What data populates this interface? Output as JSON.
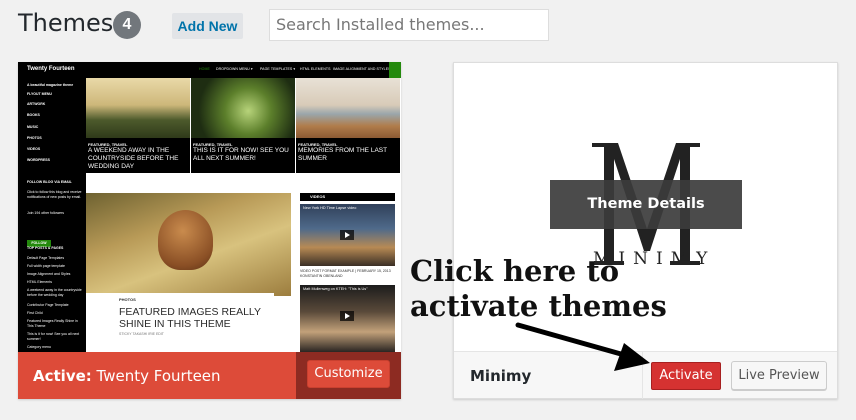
{
  "header": {
    "title": "Themes",
    "count": "4",
    "add_new": "Add New",
    "search_placeholder": "Search Installed themes..."
  },
  "active_theme": {
    "prefix": "Active:",
    "name": "Twenty Fourteen",
    "customize_label": "Customize",
    "screenshot": {
      "brand": "Twenty Fourteen",
      "tagline": "A beautiful magazine theme",
      "nav": [
        "HOME",
        "DROPDOWN MENU ▾",
        "PAGE TEMPLATES ▾",
        "HTML ELEMENTS",
        "IMAGE ALIGNMENT AND STYLES"
      ],
      "sidebar_menu": [
        "FLYOUT MENU",
        "ARTWORK",
        "BOOKS",
        "MUSIC",
        "PHOTOS",
        "VIDEOS",
        "WORDPRESS"
      ],
      "follow_heading": "FOLLOW BLOG VIA EMAIL",
      "follow_text": "Click to follow this blog and receive notifications of new posts by email.",
      "follow_count": "Join 194 other followers",
      "follow_button": "FOLLOW",
      "top_posts_heading": "TOP POSTS & PAGES",
      "top_posts": [
        "Default Page Templates",
        "Full width page template",
        "Image Alignment and Styles",
        "HTML Elements",
        "A weekend away in the countryside before the wedding day",
        "Contributor Page Template",
        "First Child",
        "Featured Images Really Shine in This Theme",
        "This is it for now! See you all next summer!",
        "Category menu"
      ],
      "featured": [
        {
          "category": "FEATURED, TRAVEL",
          "title": "A WEEKEND AWAY IN THE COUNTRYSIDE BEFORE THE WEDDING DAY"
        },
        {
          "category": "FEATURED, TRAVEL",
          "title": "THIS IS IT FOR NOW! SEE YOU ALL NEXT SUMMER!"
        },
        {
          "category": "FEATURED, TRAVEL",
          "title": "MEMORIES FROM THE LAST SUMMER"
        }
      ],
      "post_category": "PHOTOS",
      "post_title": "FEATURED IMAGES REALLY SHINE IN THIS THEME",
      "post_meta": "STICKY   TAKASHI IRIE   EDIT",
      "videos_heading": "VIDEOS",
      "video1_title": "New York HD Time Lapse video",
      "video1_caption": "VIDEO POST FORMAT EXAMPLE | FEBRUARY 15, 2013 KONSTANTIN OBENLAND",
      "video2_title": "Matt Mullenweg on KTEH: \"This is Us\""
    }
  },
  "theme2": {
    "name": "Minimy",
    "logo_letter": "M",
    "logo_word": "MINIMY",
    "details_label": "Theme Details",
    "activate_label": "Activate",
    "preview_label": "Live Preview"
  },
  "annotation": {
    "line1": "Click here to",
    "line2": "activate themes"
  }
}
